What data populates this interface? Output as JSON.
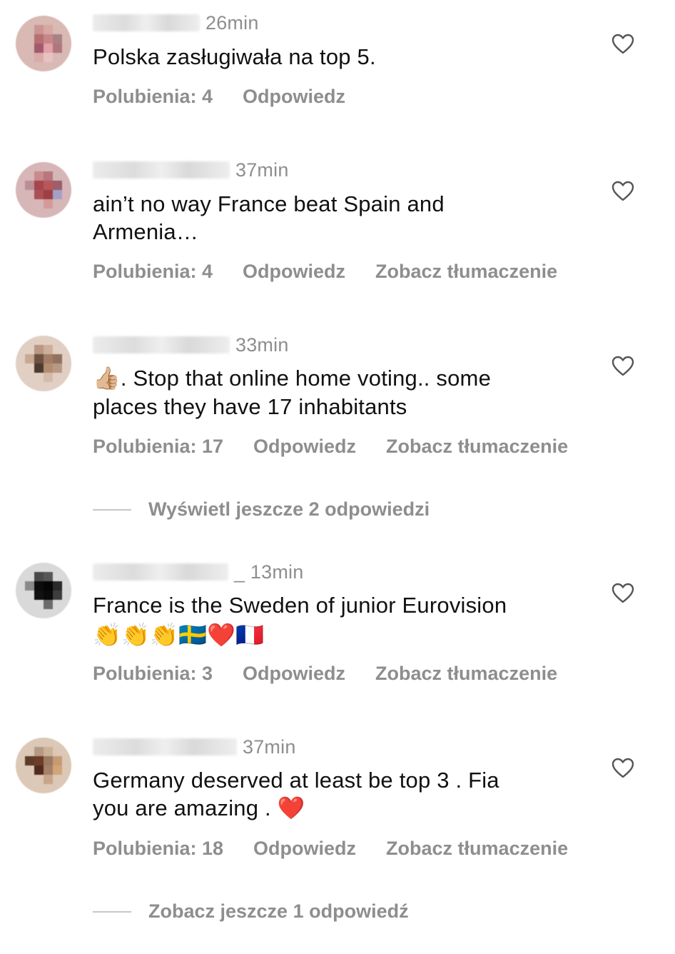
{
  "like_label_prefix": "Polubienia:",
  "reply_label": "Odpowiedz",
  "translate_label": "Zobacz tłumaczenie",
  "comments": [
    {
      "time": "26min",
      "text": "Polska zasługiwała na top 5.",
      "likes": "Polubienia: 4",
      "reply": "Odpowiedz",
      "translate": "",
      "more_replies": ""
    },
    {
      "time": "37min",
      "text_line1": "ain’t no way France beat Spain and",
      "text_line2": "Armenia…",
      "likes": "Polubienia: 4",
      "reply": "Odpowiedz",
      "translate": "Zobacz tłumaczenie"
    },
    {
      "time": "33min",
      "emoji_prefix": "👍🏼",
      "text_line1": ". Stop that online home voting.. some",
      "text_line2": "places they have 17 inhabitants",
      "likes": "Polubienia: 17",
      "reply": "Odpowiedz",
      "translate": "Zobacz tłumaczenie",
      "more_replies": "Wyświetl jeszcze 2 odpowiedzi"
    },
    {
      "time": "_ 13min",
      "text_line1": "France is the Sweden of junior Eurovision",
      "emojis": "👏👏👏🇸🇪❤️🇫🇷",
      "likes": "Polubienia: 3",
      "reply": "Odpowiedz",
      "translate": "Zobacz tłumaczenie"
    },
    {
      "time": "37min",
      "text_line1": "Germany deserved at least be top 3 . Fia",
      "text_line2": "you are amazing . ",
      "heart_emoji": "❤️",
      "likes": "Polubienia: 18",
      "reply": "Odpowiedz",
      "translate": "Zobacz tłumaczenie",
      "more_replies": "Zobacz jeszcze 1 odpowiedź"
    }
  ],
  "colors": {
    "text": "#111111",
    "secondary": "#8e8e8e",
    "divider": "#c7c7c7",
    "emoji_heart": "#e0142b"
  }
}
